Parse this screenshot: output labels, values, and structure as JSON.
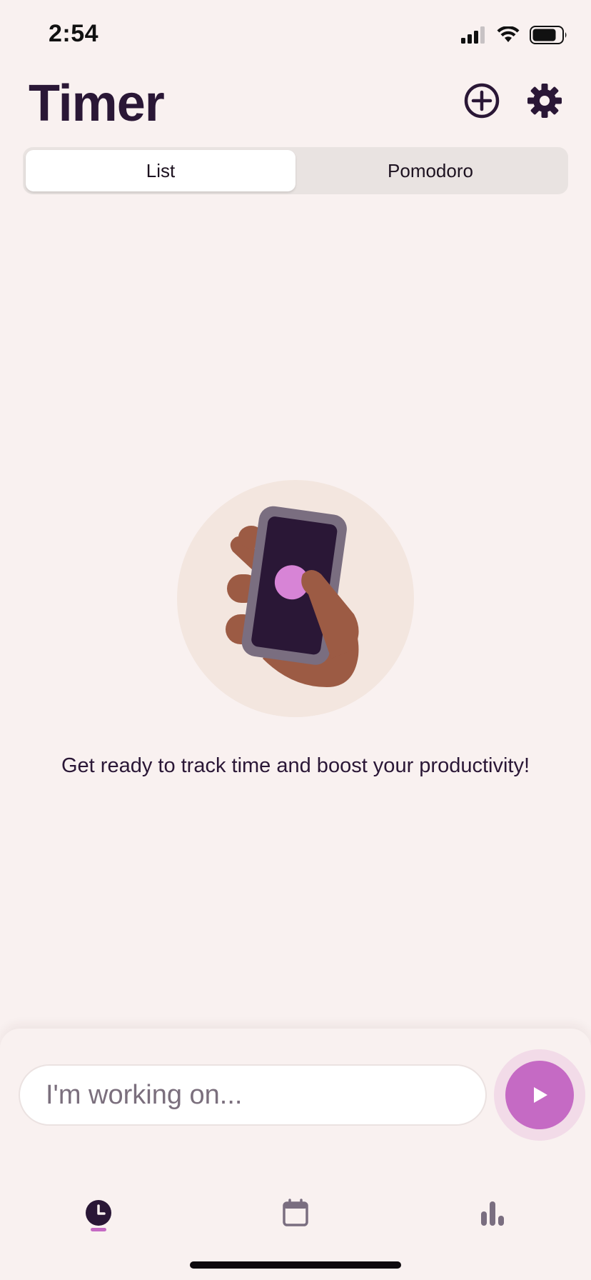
{
  "status_bar": {
    "time": "2:54"
  },
  "header": {
    "title": "Timer"
  },
  "segmented_control": {
    "tabs": [
      {
        "label": "List",
        "active": true
      },
      {
        "label": "Pomodoro",
        "active": false
      }
    ]
  },
  "empty_state": {
    "message": "Get ready to track time and boost your productivity!"
  },
  "composer": {
    "placeholder": "I'm working on...",
    "value": ""
  },
  "tab_bar": {
    "items": [
      {
        "icon": "clock-icon",
        "active": true
      },
      {
        "icon": "calendar-icon",
        "active": false
      },
      {
        "icon": "bar-chart-icon",
        "active": false
      }
    ]
  },
  "colors": {
    "background": "#f9f1f0",
    "primary_text": "#2a1736",
    "accent": "#c56ac4",
    "segment_track": "#e9e3e1"
  }
}
